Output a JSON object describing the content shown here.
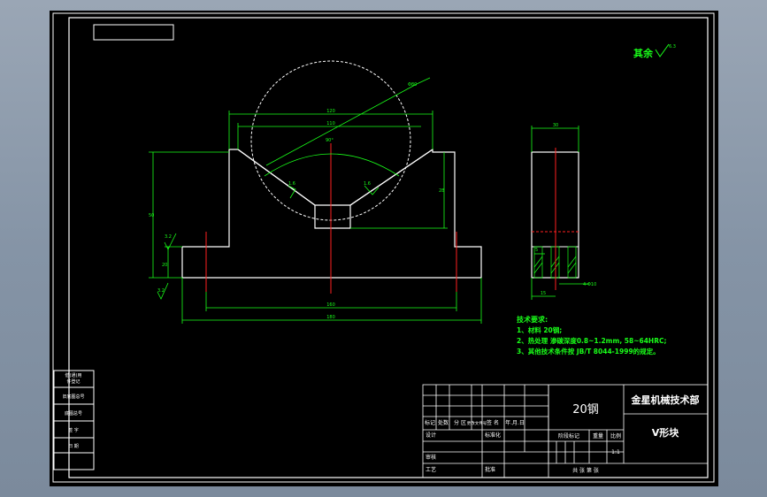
{
  "colors": {
    "background": "#000000",
    "outline": "#ffffff",
    "dimension": "#19ff19",
    "centerline": "#ff2020"
  },
  "drawing": {
    "roughness_note": {
      "label": "其余",
      "value": "6.3"
    },
    "dimensions_front": {
      "overall_width": "180",
      "base_span": "160",
      "top_width": "120",
      "inner_width": "110",
      "v_angle": "90°",
      "circle_dia": "Φ80",
      "height": "50",
      "vee_depth": "28",
      "base_height": "20",
      "rough_left": "3.2",
      "rough_left_bottom": "3.2",
      "rough_vee_left": "1.6",
      "rough_vee_right": "1.6"
    },
    "dimensions_side": {
      "width": "30",
      "depth_a": "15",
      "hole_dia": "4-Φ10",
      "small": "5"
    },
    "tech_requirements": {
      "title": "技术要求:",
      "items": [
        "1、材料 20钢;",
        "2、热处理 渗碳深度0.8~1.2mm, 58~64HRC;",
        "3、其他技术条件按 JB/T 8044-1999的规定。"
      ]
    }
  },
  "title_block": {
    "material": "20钢",
    "company": "金星机械技术部",
    "part_name": "V形块",
    "scale": "1:1",
    "row_headers": [
      "标记",
      "处数",
      "分 区",
      "更改文件号",
      "签 名",
      "年.月.日"
    ],
    "design": "设计",
    "standardize": "标准化",
    "stage_mark": "阶段标记",
    "weight": "重量",
    "ratio": "比例",
    "review": "审核",
    "process": "工艺",
    "approve": "批准",
    "sheets": "共    张  第    张"
  },
  "side_strip": {
    "items": [
      "借(通)用",
      "件登记",
      "旧底图总号",
      "底图总号",
      "签  字",
      "日  期"
    ]
  }
}
